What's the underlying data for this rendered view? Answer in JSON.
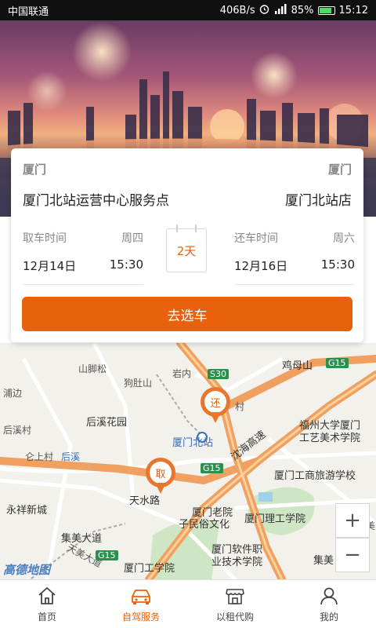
{
  "status_bar": {
    "carrier": "中国联通",
    "speed": "406B/s",
    "battery_percent": "85%",
    "battery_level": 0.85,
    "time": "15:12"
  },
  "booking": {
    "pickup_city": "厦门",
    "return_city": "厦门",
    "pickup_store": "厦门北站运营中心服务点",
    "return_store": "厦门北站店",
    "pickup": {
      "label": "取车时间",
      "weekday": "周四",
      "date": "12月14日",
      "time": "15:30"
    },
    "return": {
      "label": "还车时间",
      "weekday": "周六",
      "date": "12月16日",
      "time": "15:30"
    },
    "duration": "2天",
    "go_button": "去选车"
  },
  "map": {
    "labels": {
      "shanjiaosong": "山脚松",
      "yannei": "岩内",
      "jimushan": "鸡母山",
      "goudushan": "狗肚山",
      "puxi": "浦边",
      "houxi_garden": "后溪花园",
      "houxi_village": "后溪村",
      "xiamen_north": "厦门北站",
      "shenhai": "沈海高速",
      "fuzhou_univ_1": "福州大学厦门",
      "fuzhou_univ_2": "工艺美术学院",
      "renshang": "仑上村",
      "houxi": "后溪",
      "tianshui": "天水路",
      "business_school": "厦门工商旅游学校",
      "yongxiang": "永祥新城",
      "laoyuan": "厦门老院",
      "zimin": "子民俗文化",
      "ligong": "厦门理工学院",
      "jimei_blvd": "集美大道",
      "gongxue": "厦门工学院",
      "software_1": "厦门软件职",
      "software_2": "业技术学院",
      "jimei": "集美",
      "tianmei": "天美",
      "tianmei_blvd": "天美大道",
      "cun": "村",
      "amap_logo": "高德地图"
    },
    "roads": {
      "s30": "S30",
      "g15_top": "G15",
      "g15_mid": "G15",
      "g15_bottom": "G15"
    },
    "pins": {
      "return_pin": "还",
      "pickup_pin": "取"
    },
    "zoom_in": "+",
    "zoom_out": "−"
  },
  "tabs": [
    {
      "label": "首页",
      "icon": "home-icon"
    },
    {
      "label": "自驾服务",
      "icon": "car-icon"
    },
    {
      "label": "以租代购",
      "icon": "shop-icon"
    },
    {
      "label": "我的",
      "icon": "user-icon"
    }
  ],
  "colors": {
    "accent": "#e8620e",
    "statusbar": "#101010",
    "highway": "#f0a060",
    "road": "#ffffff"
  }
}
